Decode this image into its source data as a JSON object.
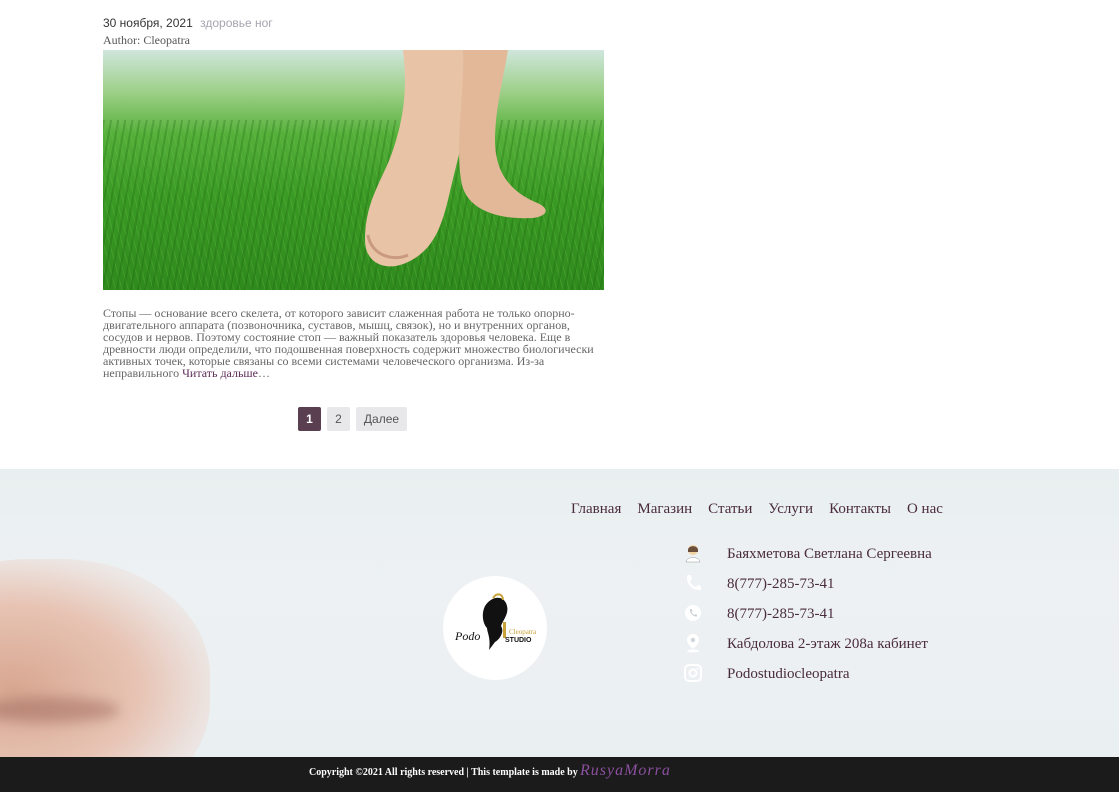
{
  "post": {
    "date": "30 ноября, 2021",
    "category": "здоровье ног",
    "author": "Author: Cleopatra",
    "excerpt": "Стопы — основание всего скелета, от которого зависит слаженная работа не только опорно-двигательного аппарата (позвоночника, суставов, мышц, связок), но и внутренних органов, сосудов и нервов. Поэтому состояние стоп — важный показатель здоровья человека. Еще в древности люди определили, что подошвенная поверхность содержит множество биологически активных точек, которые связаны со всеми системами человеческого организма. Из-за неправильного ",
    "read_more": "Читать дальше",
    "ellipsis": "…"
  },
  "pagination": {
    "page1": "1",
    "page2": "2",
    "next": "Далее"
  },
  "footer": {
    "nav": [
      "Главная",
      "Магазин",
      "Статьи",
      "Услуги",
      "Контакты",
      "О нас"
    ],
    "contacts": [
      {
        "icon": "person-icon",
        "text": "Баяхметова Светлана Сергеевна"
      },
      {
        "icon": "phone-icon",
        "text": "8(777)-285-73-41"
      },
      {
        "icon": "whatsapp-icon",
        "text": "8(777)-285-73-41"
      },
      {
        "icon": "location-icon",
        "text": "Кабдолова 2-этаж 208а кабинет"
      },
      {
        "icon": "instagram-icon",
        "text": "Podostudiocleopatra"
      }
    ],
    "logo_text_1": "Podo",
    "logo_text_2": "Cleopatra",
    "logo_text_3": "STUDIO",
    "copyright": "Copyright ©2021 All rights reserved | This template is made by",
    "brand": "RusyaMorra"
  },
  "colors": {
    "accent": "#5a3f50",
    "text_dark": "#4a2b3e",
    "footer_bar": "#1b1b1b"
  }
}
